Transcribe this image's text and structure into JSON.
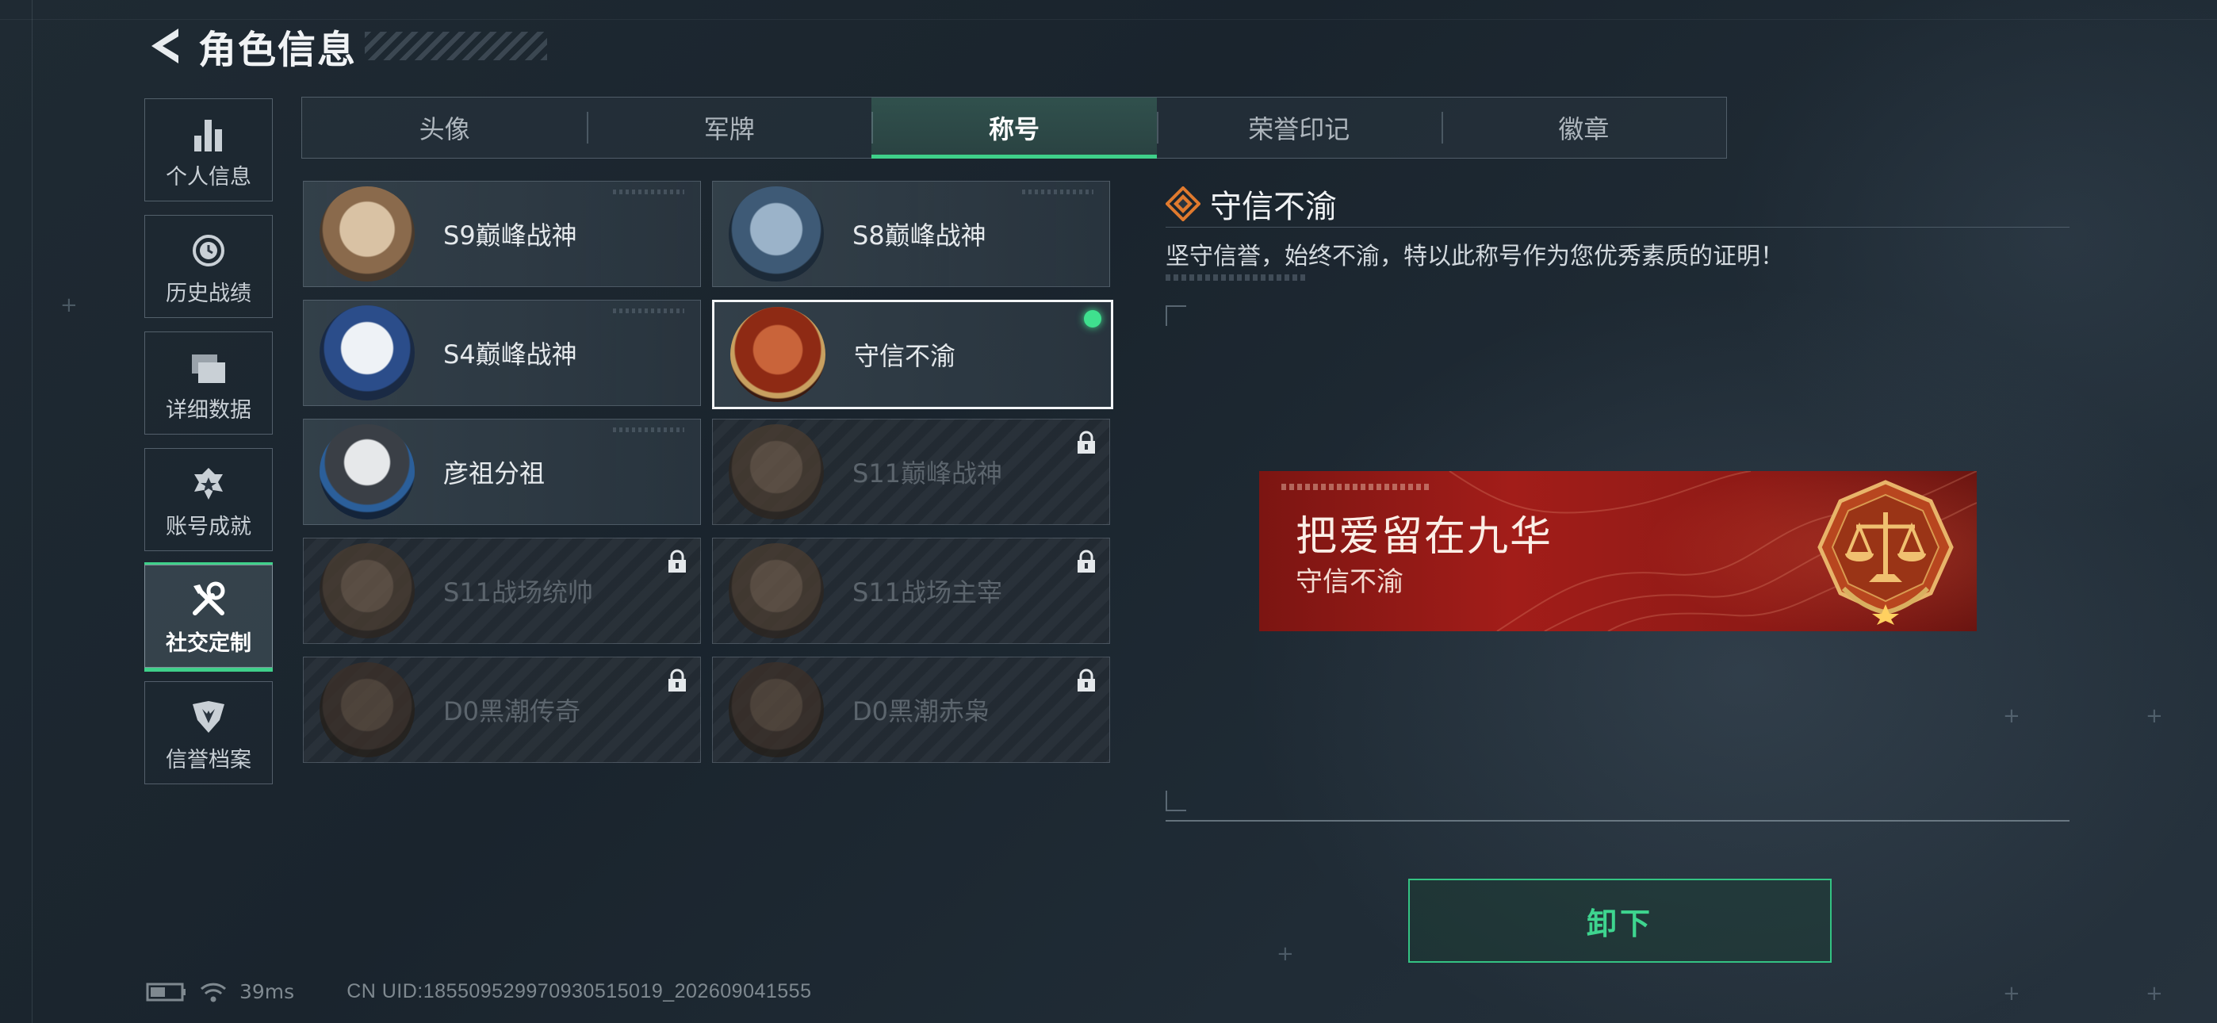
{
  "header": {
    "title": "角色信息"
  },
  "sidebar": {
    "items": [
      {
        "label": "个人信息",
        "icon": "bar-chart-icon",
        "active": false
      },
      {
        "label": "历史战绩",
        "icon": "clock-history-icon",
        "active": false
      },
      {
        "label": "详细数据",
        "icon": "stacked-cards-icon",
        "active": false
      },
      {
        "label": "账号成就",
        "icon": "star-emblem-icon",
        "active": false
      },
      {
        "label": "社交定制",
        "icon": "wrench-tools-icon",
        "active": true
      },
      {
        "label": "信誉档案",
        "icon": "shield-wings-icon",
        "active": false
      }
    ]
  },
  "tabs": [
    {
      "label": "头像",
      "active": false
    },
    {
      "label": "军牌",
      "active": false
    },
    {
      "label": "称号",
      "active": true
    },
    {
      "label": "荣誉印记",
      "active": false
    },
    {
      "label": "徽章",
      "active": false
    }
  ],
  "titles": [
    {
      "name": "S9巅峰战神",
      "locked": false,
      "selected": false,
      "medal": "#b48d6a"
    },
    {
      "name": "S8巅峰战神",
      "locked": false,
      "selected": false,
      "medal": "#5f7d99"
    },
    {
      "name": "S4巅峰战神",
      "locked": false,
      "selected": false,
      "medal": "#c7cfd8"
    },
    {
      "name": "守信不渝",
      "locked": false,
      "selected": true,
      "equipped": true,
      "medal": "#9b3a1c"
    },
    {
      "name": "彦祖分祖",
      "locked": false,
      "selected": false,
      "medal": "#2d5a8a"
    },
    {
      "name": "S11巅峰战神",
      "locked": true,
      "selected": false,
      "medal": "#5a4a3c"
    },
    {
      "name": "S11战场统帅",
      "locked": true,
      "selected": false,
      "medal": "#5a4a3c"
    },
    {
      "name": "S11战场主宰",
      "locked": true,
      "selected": false,
      "medal": "#5a4a3c"
    },
    {
      "name": "D0黑潮传奇",
      "locked": true,
      "selected": false,
      "medal": "#4a3a30"
    },
    {
      "name": "D0黑潮赤枭",
      "locked": true,
      "selected": false,
      "medal": "#4a3a30"
    }
  ],
  "detail": {
    "title": "守信不渝",
    "description": "坚守信誉，始终不渝，特以此称号作为您优秀素质的证明！",
    "banner": {
      "main": "把爱留在九华",
      "sub": "守信不渝"
    },
    "action_label": "卸下"
  },
  "status": {
    "ping": "39ms",
    "uid": "CN UID:1855095299709305150​19_202609041555"
  },
  "colors": {
    "accent": "#3fd08a",
    "banner": "#a21d19",
    "equipped_dot": "#3fe08e"
  }
}
